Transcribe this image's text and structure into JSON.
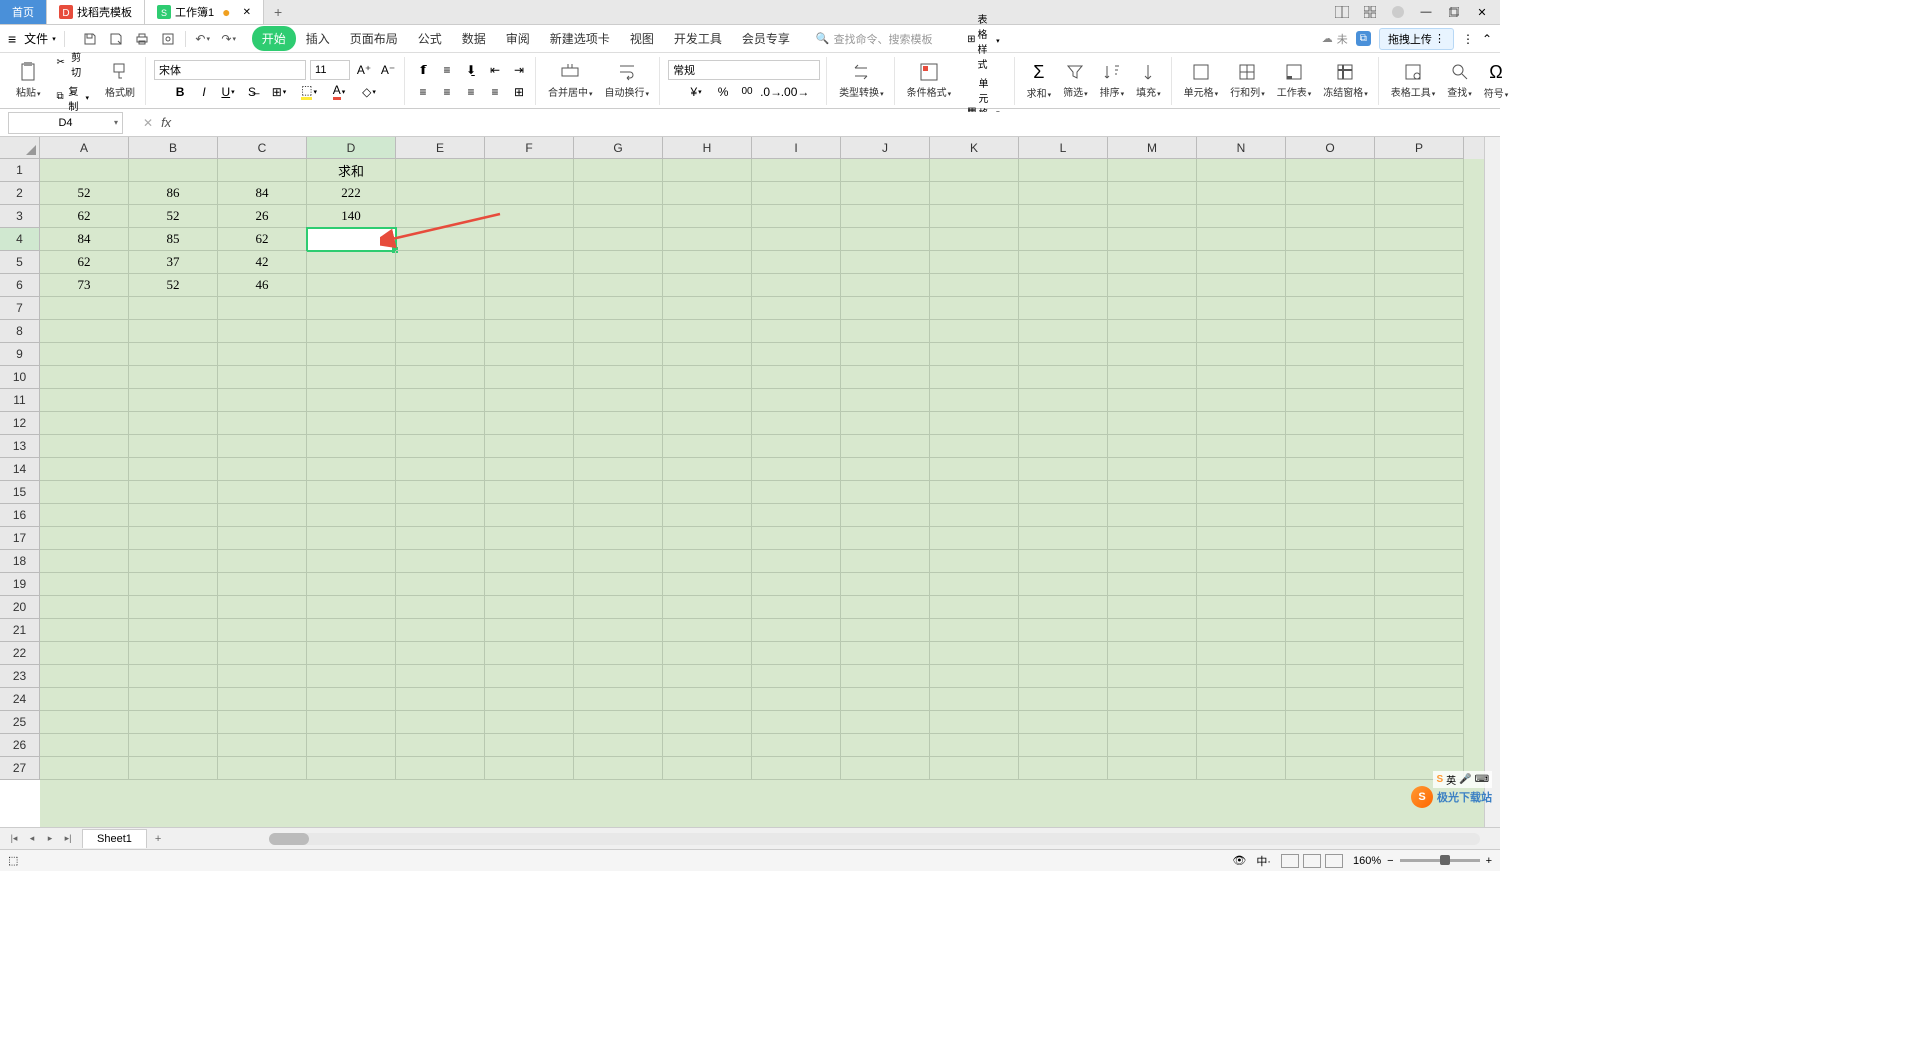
{
  "tabs": {
    "home": "首页",
    "template": "找稻壳模板",
    "doc": "工作簿1"
  },
  "file_menu": "文件",
  "menu": {
    "start": "开始",
    "insert": "插入",
    "page_layout": "页面布局",
    "formulas": "公式",
    "data": "数据",
    "review": "审阅",
    "new_tab": "新建选项卡",
    "view": "视图",
    "dev_tools": "开发工具",
    "member": "会员专享"
  },
  "search_placeholder": "查找命令、搜索模板",
  "cloud": {
    "unsaved": "未",
    "upload": "拖拽上传"
  },
  "ribbon": {
    "paste": "粘贴",
    "cut": "剪切",
    "copy": "复制",
    "fmt_painter": "格式刷",
    "font_name": "宋体",
    "font_size": "11",
    "merge_center": "合并居中",
    "wrap_text": "自动换行",
    "number_fmt": "常规",
    "type_convert": "类型转换",
    "cond_fmt": "条件格式",
    "table_style": "表格样式",
    "cell_style": "单元格样式",
    "sum": "求和",
    "filter": "筛选",
    "sort": "排序",
    "fill": "填充",
    "cell": "单元格",
    "row_col": "行和列",
    "worksheet": "工作表",
    "freeze": "冻结窗格",
    "table_tools": "表格工具",
    "find": "查找",
    "symbol": "符号"
  },
  "name_box": "D4",
  "fx": "fx",
  "columns": [
    "A",
    "B",
    "C",
    "D",
    "E",
    "F",
    "G",
    "H",
    "I",
    "J",
    "K",
    "L",
    "M",
    "N",
    "O",
    "P"
  ],
  "grid": {
    "rows": 27,
    "data": [
      {
        "r": 1,
        "D": "求和"
      },
      {
        "r": 2,
        "A": "52",
        "B": "86",
        "C": "84",
        "D": "222"
      },
      {
        "r": 3,
        "A": "62",
        "B": "52",
        "C": "26",
        "D": "140"
      },
      {
        "r": 4,
        "A": "84",
        "B": "85",
        "C": "62"
      },
      {
        "r": 5,
        "A": "62",
        "B": "37",
        "C": "42"
      },
      {
        "r": 6,
        "A": "73",
        "B": "52",
        "C": "46"
      }
    ],
    "selected": {
      "row": 4,
      "col": "D"
    }
  },
  "sheet": {
    "name": "Sheet1"
  },
  "status": {
    "zoom": "160%"
  },
  "watermark": {
    "text": "极光下载站"
  },
  "ime": {
    "lang": "英"
  }
}
